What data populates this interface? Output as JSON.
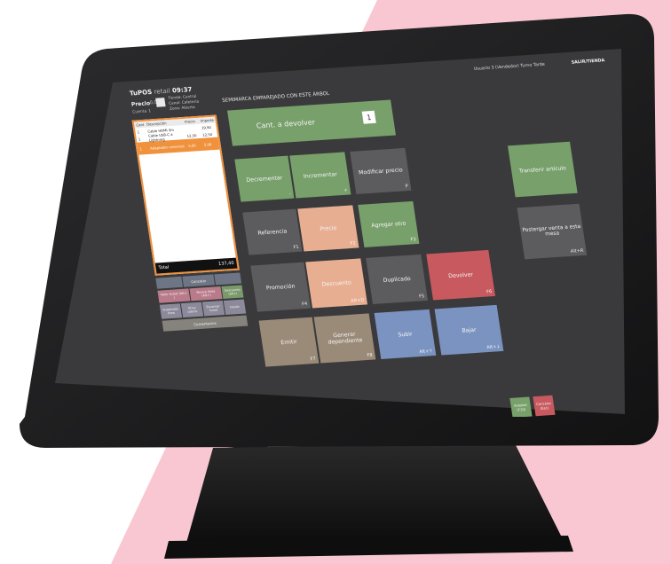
{
  "header": {
    "logo": "TuPOS",
    "logo_suffix": "retail",
    "time": "09:37",
    "user_info": "Usuario 3 (Vendedor) Turno Tarde",
    "exit_label": "SALIR/TIENDA"
  },
  "panel": {
    "price_label": "Precio",
    "price_value": "0,00",
    "account_label": "Cuenta",
    "account_value": "1",
    "meta": [
      "Tienda: Central",
      "Canal: Cafetería",
      "Zona: Abierta"
    ]
  },
  "ticket": {
    "headers": [
      "Cant",
      "Descripción",
      "Precio",
      "Importe"
    ],
    "rows": [
      [
        "1",
        "Cable HDMI 3m",
        "",
        "19,90"
      ],
      [
        "1",
        "Cable USB-C a Lightning",
        "12,50",
        "12,50"
      ],
      [
        "1",
        "Adaptador universal",
        "5,00",
        "5,00"
      ]
    ],
    "selected_index": 2,
    "total_label": "Total",
    "total_value": "137,40"
  },
  "left_buttons": {
    "row1": [
      "",
      "Cancelar",
      ""
    ],
    "row2": [
      "Valor ticket (Alt+ )",
      "Nueva línea (Alt+)",
      "Descuento (Alt+)"
    ],
    "row3": [
      "Suspender línea",
      "Otros cobros",
      "Escanear ticket",
      "Dividir"
    ],
    "bottom": "Comentarios"
  },
  "main": {
    "title": "SEMIMARCA EMPAREJADO CON ESTE ÁRBOL",
    "qty_label": "Cant. a devolver",
    "qty_value": "1",
    "tiles": [
      {
        "label": "Decrementar",
        "key": "-",
        "color": "green"
      },
      {
        "label": "Incrementar",
        "key": "+",
        "color": "green"
      },
      {
        "label": "Modificar precio",
        "key": "P",
        "color": "grey"
      },
      {
        "label": "Referencia",
        "key": "F1",
        "color": "grey"
      },
      {
        "label": "Precio",
        "key": "F2",
        "color": "peach"
      },
      {
        "label": "Agregar otro",
        "key": "F3",
        "color": "green"
      },
      {
        "label": "Promoción",
        "key": "F4",
        "color": "grey"
      },
      {
        "label": "Descuento",
        "key": "Alt+D",
        "color": "peach"
      },
      {
        "label": "Duplicado",
        "key": "F5",
        "color": "grey"
      },
      {
        "label": "Devolver",
        "key": "F6",
        "color": "red"
      },
      {
        "label": "Emitir",
        "key": "F7",
        "color": "tan"
      },
      {
        "label": "Generar dependiente",
        "key": "F8",
        "color": "tan"
      },
      {
        "label": "Subir",
        "key": "Alt+↑",
        "color": "blue"
      },
      {
        "label": "Bajar",
        "key": "Alt+↓",
        "color": "blue"
      }
    ],
    "right_tiles": [
      {
        "label": "Transferir artículo",
        "key": "",
        "color": "green"
      },
      {
        "label": "Postergar venta a esta mesa",
        "key": "Alt+R",
        "color": "grey"
      }
    ],
    "accept_label": "Aceptar (F10)",
    "cancel_label": "Cancelar (Esc)"
  },
  "colors": {
    "pink": "#f9c7d1",
    "bezel": "#1b1b1c",
    "screen": "#3b3b3d"
  }
}
